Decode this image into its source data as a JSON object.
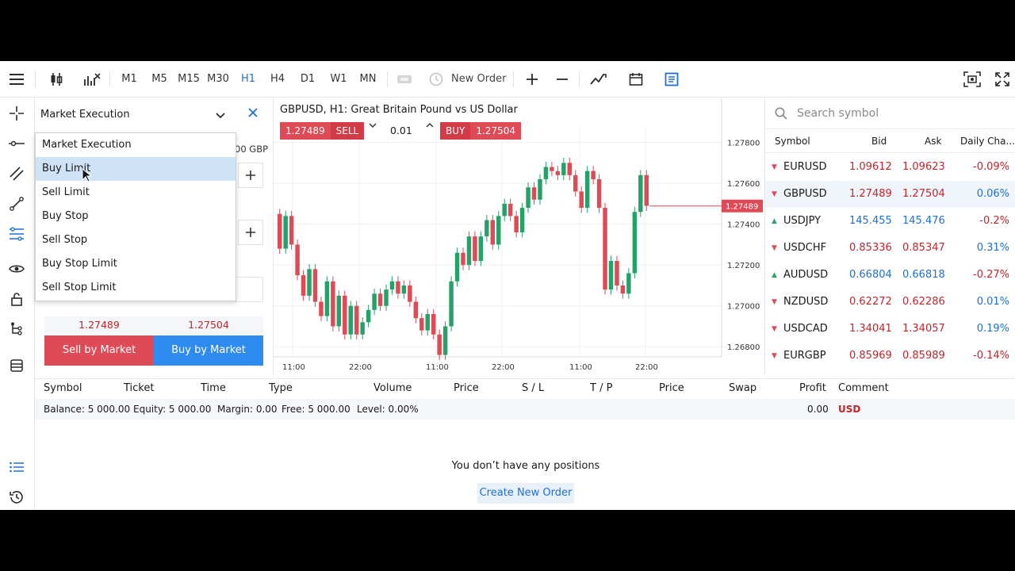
{
  "toolbar": {
    "timeframes": [
      "M1",
      "M5",
      "M15",
      "M30",
      "H1",
      "H4",
      "D1",
      "W1",
      "MN"
    ],
    "active_timeframe": "H1",
    "new_order_label": "New Order"
  },
  "order_panel": {
    "execution_selected": "Market Execution",
    "ghost_currency": "00 GBP",
    "dropdown_options": [
      "Market Execution",
      "Buy Limit",
      "Sell Limit",
      "Buy Stop",
      "Sell Stop",
      "Buy Stop Limit",
      "Sell Stop Limit"
    ],
    "hovered_option": "Buy Limit",
    "bid": "1.27489",
    "ask": "1.27504",
    "sell_label": "Sell by Market",
    "buy_label": "Buy by Market"
  },
  "chart": {
    "title": "GBPUSD, H1: Great Britain Pound vs US Dollar",
    "sell_price": "1.27489",
    "sell_label": "SELL",
    "volume": "0.01",
    "buy_label": "BUY",
    "buy_price": "1.27504",
    "current_price_label": "1.27489"
  },
  "chart_data": {
    "type": "candlestick",
    "title": "GBPUSD, H1: Great Britain Pound vs US Dollar",
    "y_ticks": [
      "1.27800",
      "1.27600",
      "1.27400",
      "1.27200",
      "1.27000",
      "1.26800"
    ],
    "x_ticks": [
      "11:00",
      "22:00",
      "11:00",
      "22:00",
      "11:00",
      "22:00"
    ],
    "ylim": [
      1.267,
      1.2788
    ],
    "current_price": 1.27489,
    "candles": [
      [
        1.2745,
        1.2728
      ],
      [
        1.2728,
        1.2744
      ],
      [
        1.2744,
        1.273
      ],
      [
        1.273,
        1.2715
      ],
      [
        1.2715,
        1.2705
      ],
      [
        1.2705,
        1.2718
      ],
      [
        1.2718,
        1.2702
      ],
      [
        1.2702,
        1.2695
      ],
      [
        1.2695,
        1.2712
      ],
      [
        1.2712,
        1.269
      ],
      [
        1.269,
        1.2705
      ],
      [
        1.2705,
        1.2686
      ],
      [
        1.2686,
        1.27
      ],
      [
        1.27,
        1.2686
      ],
      [
        1.2686,
        1.2692
      ],
      [
        1.2692,
        1.2698
      ],
      [
        1.2698,
        1.2706
      ],
      [
        1.2706,
        1.27
      ],
      [
        1.27,
        1.2708
      ],
      [
        1.2708,
        1.2712
      ],
      [
        1.2712,
        1.2706
      ],
      [
        1.2706,
        1.271
      ],
      [
        1.271,
        1.2702
      ],
      [
        1.2702,
        1.2694
      ],
      [
        1.2694,
        1.2688
      ],
      [
        1.2688,
        1.2696
      ],
      [
        1.2696,
        1.2686
      ],
      [
        1.2686,
        1.2676
      ],
      [
        1.2676,
        1.269
      ],
      [
        1.269,
        1.2712
      ],
      [
        1.2712,
        1.2726
      ],
      [
        1.2726,
        1.272
      ],
      [
        1.272,
        1.2734
      ],
      [
        1.2734,
        1.2722
      ],
      [
        1.2722,
        1.2734
      ],
      [
        1.2734,
        1.2742
      ],
      [
        1.2742,
        1.273
      ],
      [
        1.273,
        1.2744
      ],
      [
        1.2744,
        1.275
      ],
      [
        1.275,
        1.2744
      ],
      [
        1.2744,
        1.2736
      ],
      [
        1.2736,
        1.2748
      ],
      [
        1.2748,
        1.2758
      ],
      [
        1.2758,
        1.2752
      ],
      [
        1.2752,
        1.2762
      ],
      [
        1.2762,
        1.2768
      ],
      [
        1.2768,
        1.2766
      ],
      [
        1.2766,
        1.2764
      ],
      [
        1.2764,
        1.277
      ],
      [
        1.277,
        1.2764
      ],
      [
        1.2764,
        1.2756
      ],
      [
        1.2756,
        1.2748
      ],
      [
        1.2748,
        1.2766
      ],
      [
        1.2766,
        1.2762
      ],
      [
        1.2762,
        1.2748
      ],
      [
        1.2748,
        1.2708
      ],
      [
        1.2708,
        1.2722
      ],
      [
        1.2722,
        1.271
      ],
      [
        1.271,
        1.2706
      ],
      [
        1.2706,
        1.2716
      ],
      [
        1.2716,
        1.2746
      ],
      [
        1.2746,
        1.2764
      ],
      [
        1.2764,
        1.2749
      ]
    ]
  },
  "watchlist": {
    "search_placeholder": "Search symbol",
    "headers": [
      "Symbol",
      "Bid",
      "Ask",
      "Daily Cha..."
    ],
    "rows": [
      {
        "symbol": "EURUSD",
        "bid": "1.09612",
        "ask": "1.09623",
        "change": "-0.09%",
        "dir": "down",
        "bidcolor": "red",
        "chgcolor": "red"
      },
      {
        "symbol": "GBPUSD",
        "bid": "1.27489",
        "ask": "1.27504",
        "change": "0.06%",
        "dir": "down",
        "bidcolor": "red",
        "chgcolor": "blue"
      },
      {
        "symbol": "USDJPY",
        "bid": "145.455",
        "ask": "145.476",
        "change": "-0.2%",
        "dir": "up",
        "bidcolor": "blue",
        "chgcolor": "red"
      },
      {
        "symbol": "USDCHF",
        "bid": "0.85336",
        "ask": "0.85347",
        "change": "0.31%",
        "dir": "down",
        "bidcolor": "red",
        "chgcolor": "blue"
      },
      {
        "symbol": "AUDUSD",
        "bid": "0.66804",
        "ask": "0.66818",
        "change": "-0.27%",
        "dir": "up",
        "bidcolor": "blue",
        "chgcolor": "red"
      },
      {
        "symbol": "NZDUSD",
        "bid": "0.62272",
        "ask": "0.62286",
        "change": "0.01%",
        "dir": "down",
        "bidcolor": "red",
        "chgcolor": "blue"
      },
      {
        "symbol": "USDCAD",
        "bid": "1.34041",
        "ask": "1.34057",
        "change": "0.19%",
        "dir": "down",
        "bidcolor": "red",
        "chgcolor": "blue"
      },
      {
        "symbol": "EURGBP",
        "bid": "0.85969",
        "ask": "0.85989",
        "change": "-0.14%",
        "dir": "down",
        "bidcolor": "red",
        "chgcolor": "red"
      }
    ]
  },
  "trade": {
    "columns": [
      "Symbol",
      "Ticket",
      "Time",
      "Type",
      "Volume",
      "Price",
      "S / L",
      "T / P",
      "Price",
      "Swap",
      "Profit",
      "Comment"
    ],
    "balance": "Balance: 5 000.00",
    "equity": "Equity: 5 000.00",
    "margin": "Margin: 0.00",
    "free": "Free: 5 000.00",
    "level": "Level: 0.00%",
    "profit": "0.00",
    "currency": "USD",
    "empty_message": "You don’t have any positions",
    "create_button": "Create New Order"
  },
  "colors": {
    "accent": "#1f6fd6",
    "sell": "#de4a55",
    "buy": "#2e8cf0",
    "up_candle": "#26a269",
    "down_candle": "#de4a55"
  }
}
